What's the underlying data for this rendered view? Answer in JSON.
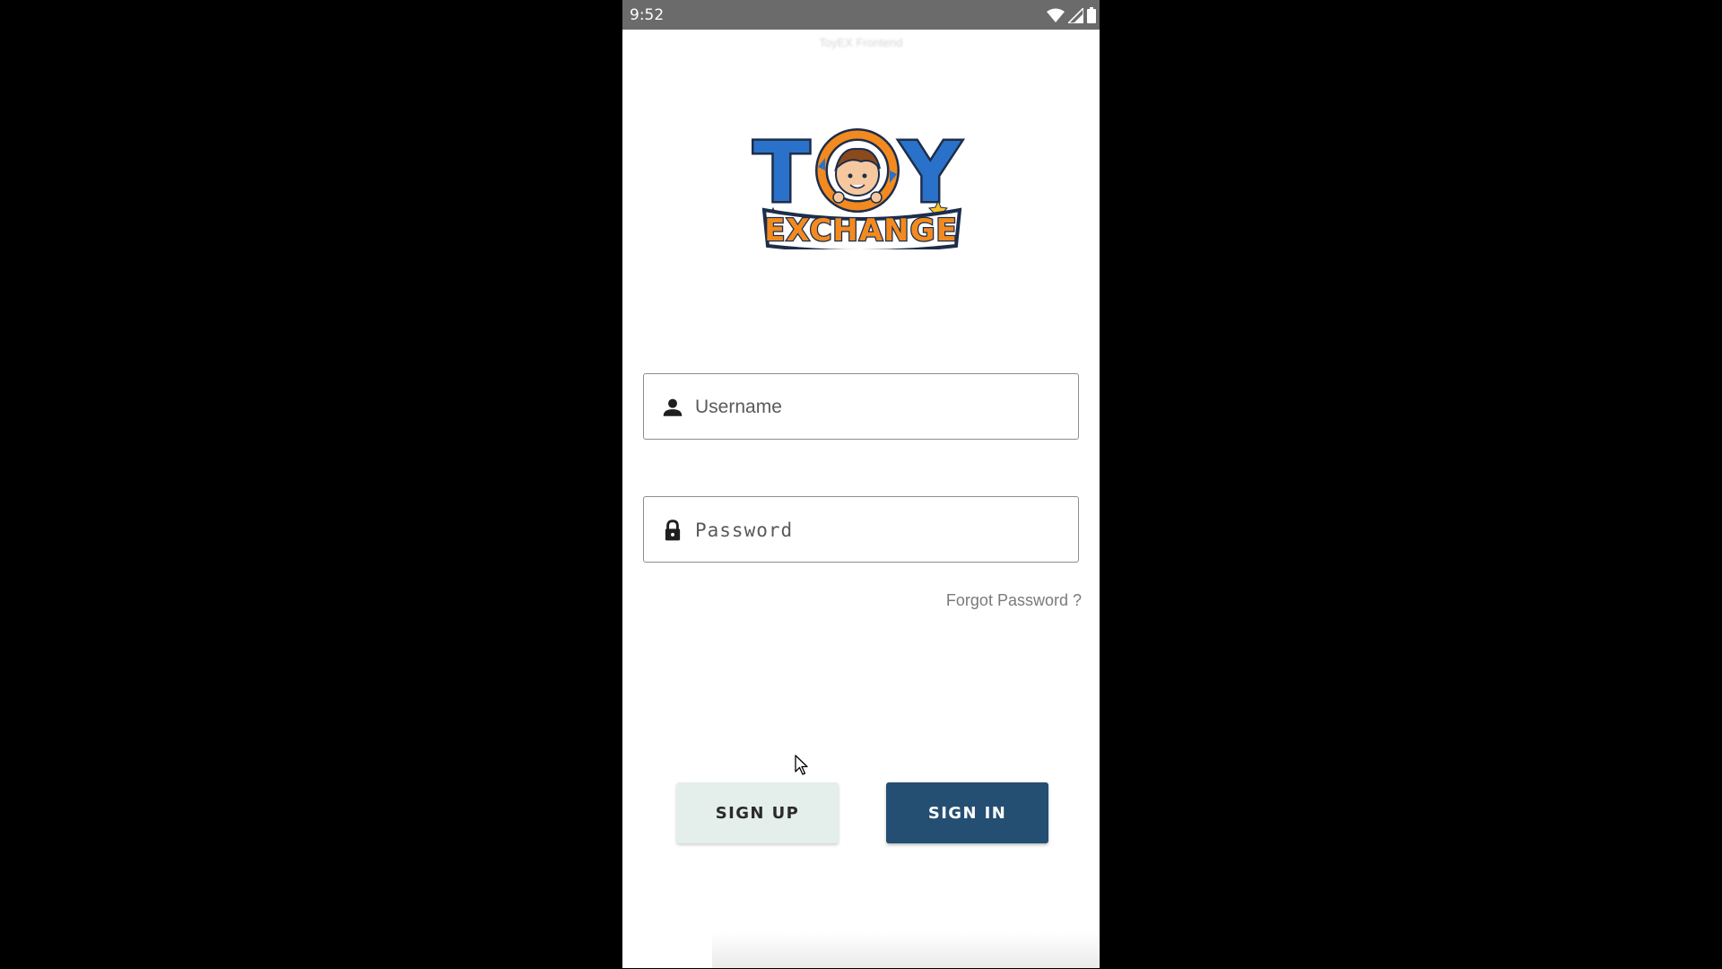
{
  "status_bar": {
    "time": "9:52",
    "icons": [
      "wifi-icon",
      "cell-signal-icon",
      "battery-icon"
    ]
  },
  "app": {
    "caption": "ToyEX Frontend"
  },
  "logo": {
    "line1": "TOY",
    "line2": "EXCHANGE",
    "colors": {
      "blue": "#2a72c9",
      "orange": "#f28a1f",
      "outline": "#1d2d4a"
    }
  },
  "form": {
    "username": {
      "placeholder": "Username",
      "icon": "person-icon"
    },
    "password": {
      "placeholder": "Password",
      "icon": "lock-icon"
    },
    "forgot_password": "Forgot Password ?"
  },
  "buttons": {
    "sign_up": "SIGN UP",
    "sign_in": "SIGN IN"
  },
  "colors": {
    "sign_in_bg": "#244e72",
    "sign_up_bg": "#e4eeea",
    "status_bar_bg": "#6b6b6b"
  }
}
